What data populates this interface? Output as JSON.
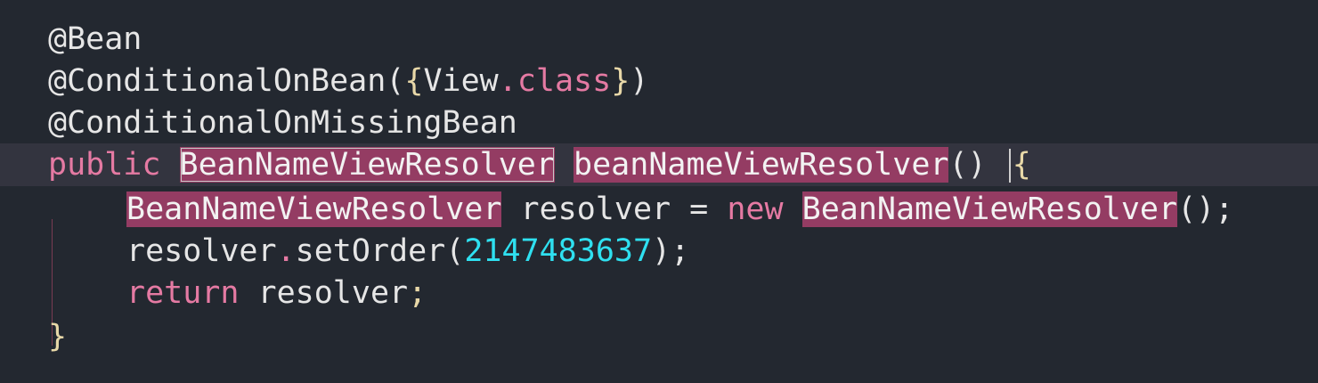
{
  "editor": {
    "line1": {
      "annotation": "@Bean"
    },
    "line2": {
      "annotation": "@ConditionalOnBean",
      "open_paren": "(",
      "open_brace": "{",
      "class_name": "View",
      "dot": ".",
      "class_kw": "class",
      "close_brace": "}",
      "close_paren": ")"
    },
    "line3": {
      "annotation": "@ConditionalOnMissingBean"
    },
    "line4": {
      "modifier": "public",
      "return_type": "BeanNameViewResolver",
      "method_name": "beanNameViewResolver",
      "parens": "()",
      "open_brace": "{"
    },
    "line5": {
      "type": "BeanNameViewResolver",
      "variable": "resolver",
      "equals": "=",
      "new_kw": "new",
      "ctor": "BeanNameViewResolver",
      "call_end": "();"
    },
    "line6": {
      "target": "resolver",
      "dot": ".",
      "method": "setOrder",
      "open_paren": "(",
      "number": "2147483637",
      "close": ");"
    },
    "line7": {
      "return_kw": "return",
      "value": "resolver",
      "semicolon": ";"
    },
    "line8": {
      "close_brace": "}"
    }
  }
}
